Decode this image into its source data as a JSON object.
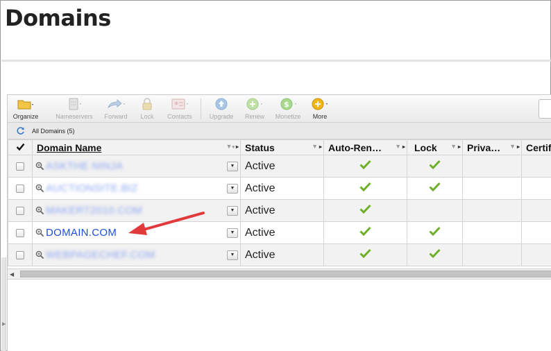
{
  "page": {
    "title": "Domains"
  },
  "toolbar": {
    "buttons": [
      {
        "label": "Organize",
        "icon": "folder-icon",
        "enabled": true
      },
      {
        "label": "Nameservers",
        "icon": "server-icon",
        "enabled": false
      },
      {
        "label": "Forward",
        "icon": "forward-arrow-icon",
        "enabled": false
      },
      {
        "label": "Lock",
        "icon": "padlock-icon",
        "enabled": false
      },
      {
        "label": "Contacts",
        "icon": "contact-card-icon",
        "enabled": false
      },
      {
        "label": "Upgrade",
        "icon": "upgrade-arrow-icon",
        "enabled": false
      },
      {
        "label": "Renew",
        "icon": "renew-plus-icon",
        "enabled": false
      },
      {
        "label": "Monetize",
        "icon": "dollar-coin-icon",
        "enabled": false
      },
      {
        "label": "More",
        "icon": "plus-circle-icon",
        "enabled": true
      }
    ]
  },
  "breadcrumb": {
    "label": "All Domains (5)"
  },
  "grid": {
    "columns": [
      "Domain Name",
      "Status",
      "Auto-Ren…",
      "Lock",
      "Priva…",
      "Certif"
    ],
    "rows": [
      {
        "domain": "ASKTHE NINJA",
        "blurred": true,
        "status": "Active",
        "auto_renew": true,
        "lock": true
      },
      {
        "domain": "AUCTIONSITE.BIZ",
        "blurred": true,
        "status": "Active",
        "auto_renew": true,
        "lock": true
      },
      {
        "domain": "MAKERT2010.COM",
        "blurred": true,
        "status": "Active",
        "auto_renew": true,
        "lock": false
      },
      {
        "domain": "DOMAIN.COM",
        "blurred": false,
        "status": "Active",
        "auto_renew": true,
        "lock": true
      },
      {
        "domain": "WEBPAGECHEF.COM",
        "blurred": true,
        "status": "Active",
        "auto_renew": true,
        "lock": true
      }
    ]
  },
  "colors": {
    "link": "#1f4fd8",
    "check": "#6fae2b",
    "callout_arrow": "#e03a3a"
  }
}
